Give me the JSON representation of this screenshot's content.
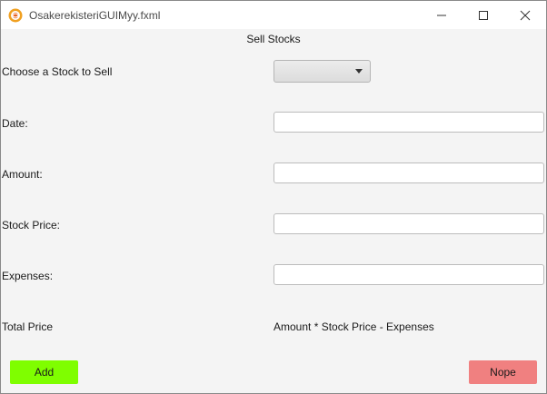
{
  "window": {
    "title": "OsakerekisteriGUIMyy.fxml",
    "icon": "javafx-app-icon",
    "controls": [
      "minimize-icon",
      "maximize-icon",
      "close-icon"
    ]
  },
  "form": {
    "heading": "Sell Stocks",
    "stock": {
      "label": "Choose a Stock to Sell",
      "selected": ""
    },
    "date": {
      "label": "Date:",
      "value": ""
    },
    "amount": {
      "label": "Amount:",
      "value": ""
    },
    "stock_price": {
      "label": "Stock Price:",
      "value": ""
    },
    "expenses": {
      "label": "Expenses:",
      "value": ""
    },
    "total": {
      "label": "Total Price",
      "formula": "Amount * Stock Price - Expenses"
    }
  },
  "buttons": {
    "add": "Add",
    "nope": "Nope"
  },
  "colors": {
    "add_button": "#7ffe00",
    "nope_button": "#f08080",
    "background": "#f4f4f4",
    "icon_accent": "#f0a020"
  }
}
